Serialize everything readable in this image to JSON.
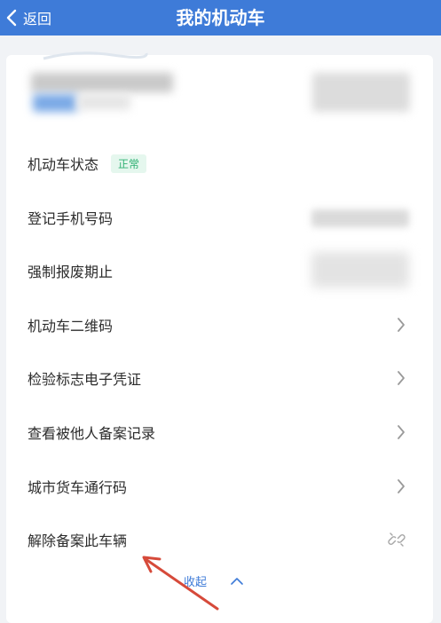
{
  "header": {
    "back_label": "返回",
    "title": "我的机动车"
  },
  "rows": [
    {
      "label": "机动车状态",
      "badge": "正常"
    },
    {
      "label": "登记手机号码"
    },
    {
      "label": "强制报废期止"
    },
    {
      "label": "机动车二维码"
    },
    {
      "label": "检验标志电子凭证"
    },
    {
      "label": "查看被他人备案记录"
    },
    {
      "label": "城市货车通行码"
    },
    {
      "label": "解除备案此车辆"
    }
  ],
  "footer": {
    "collapse_label": "收起"
  },
  "colors": {
    "accent": "#3e7bd8",
    "status_green": "#2fb073",
    "annotation_arrow": "#d64a3a"
  },
  "icons": {
    "back": "chevron-left-icon",
    "row_arrow": "chevron-right-icon",
    "unlink": "link-icon",
    "collapse": "chevron-up-icon"
  }
}
